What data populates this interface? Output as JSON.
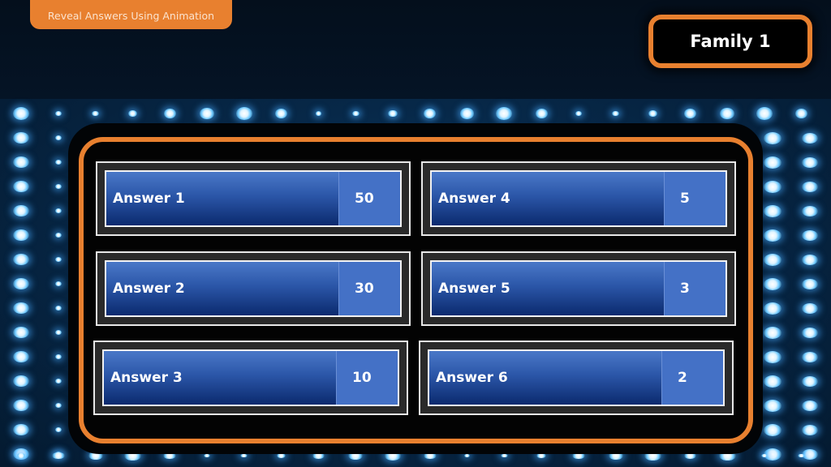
{
  "header": {
    "title": "Reveal Answers Using Animation",
    "team": "Family 1"
  },
  "colors": {
    "accent": "#e8802f",
    "tile_blue": "#2b56a8",
    "points_blue": "#4471c6",
    "background": "#030d18"
  },
  "answers": [
    {
      "label": "Answer 1",
      "points": "50"
    },
    {
      "label": "Answer 2",
      "points": "30"
    },
    {
      "label": "Answer 3",
      "points": "10"
    },
    {
      "label": "Answer 4",
      "points": "5"
    },
    {
      "label": "Answer 5",
      "points": "3"
    },
    {
      "label": "Answer 6",
      "points": "2"
    }
  ]
}
